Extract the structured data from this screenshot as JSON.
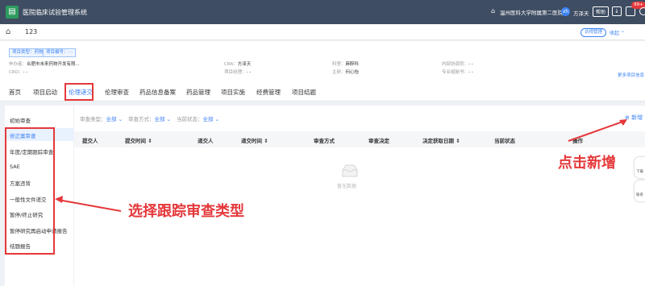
{
  "app": {
    "title": "医院临床试验管理系统",
    "hospital": "温州医科大学附属第二医院",
    "user_avatar": "xh",
    "username": "方泽天",
    "help_label": "帮助",
    "notif_count": "99+"
  },
  "breadcrumb": {
    "project_name": "123",
    "visit_btn": "访视管理",
    "collapse_label": "收起"
  },
  "project_info": {
    "tags": [
      {
        "label": "项目类型：药物"
      },
      {
        "label": "项目编号：- -"
      }
    ],
    "fields": [
      {
        "k": "申办者：",
        "v": "合肥市未来药物开发有限..."
      },
      {
        "k": "CRO：",
        "v": "- -"
      },
      {
        "k": "CRA：",
        "v": "方泽天"
      },
      {
        "k": "项目经理：",
        "v": "- -"
      },
      {
        "k": "科室：",
        "v": "麻醉科"
      },
      {
        "k": "主研：",
        "v": "何心怡"
      },
      {
        "k": "内部协调员：",
        "v": "- -"
      },
      {
        "k": "专业组秘书：",
        "v": "- -"
      }
    ],
    "more_link": "更多项目信息"
  },
  "tabs": [
    "首页",
    "项目启动",
    "伦理递交",
    "伦理审查",
    "药品信息备案",
    "药品管理",
    "项目实施",
    "经费管理",
    "项目结题"
  ],
  "sidebar": [
    "初始审查",
    "修正案审查",
    "年度/定期跟踪审查",
    "SAE",
    "方案违背",
    "一般性文件递交",
    "暂停/终止研究",
    "暂停研究再启动申请报告",
    "结题报告"
  ],
  "filters": [
    {
      "k": "审查类型：",
      "v": "全部 ⌄"
    },
    {
      "k": "审查方式：",
      "v": "全部 ⌄"
    },
    {
      "k": "当前状态：",
      "v": "全部 ⌄"
    }
  ],
  "new_button": "⊕ 新增",
  "table": {
    "headers": [
      "提交人",
      "提交时间 ⇕",
      "递交人",
      "递交时间 ⇕",
      "审查方式",
      "审查决定",
      "决定获取日期 ⇕",
      "当前状态",
      "操作"
    ],
    "empty_text": "暂无数据"
  },
  "floating": [
    "下载",
    "联系"
  ],
  "annotations": {
    "new_hint": "点击新增",
    "sidebar_hint": "选择跟踪审查类型"
  },
  "colors": {
    "topbar": "#3f4d62",
    "accent": "#3b82f6",
    "annotation": "#e5383b"
  }
}
